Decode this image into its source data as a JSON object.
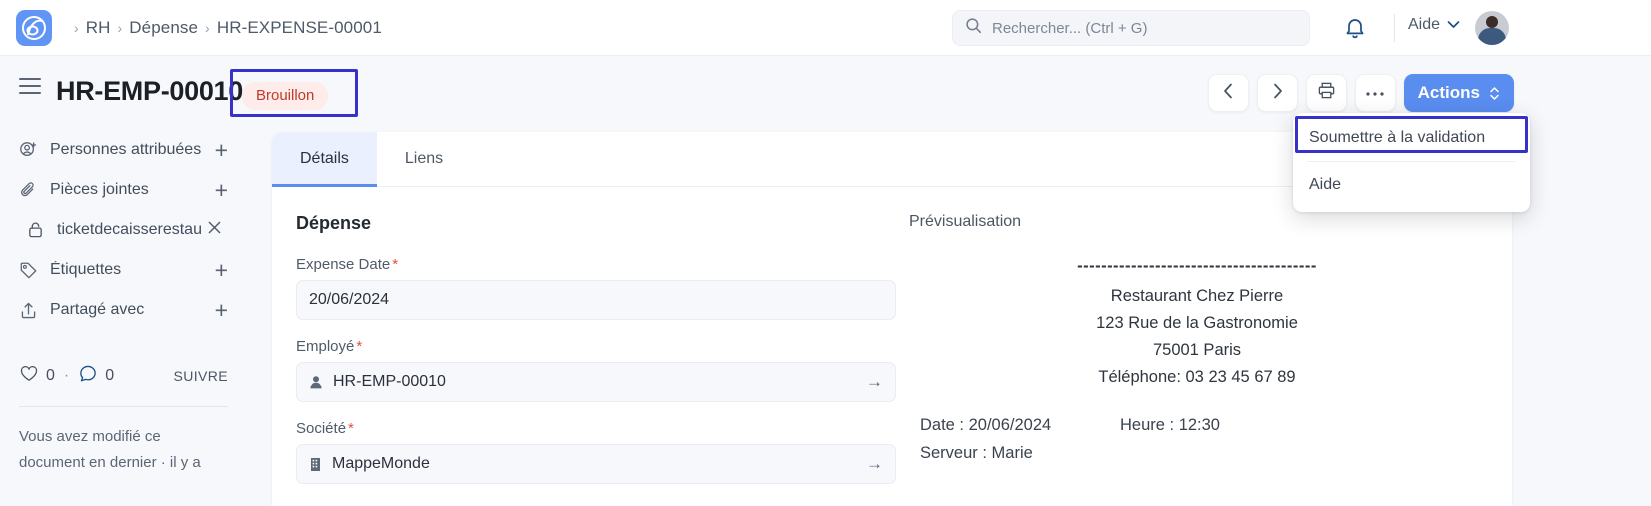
{
  "navbar": {
    "logo_icon": "app-logo-icon",
    "breadcrumb": {
      "sep": "›",
      "items": [
        "RH",
        "Dépense",
        "HR-EXPENSE-00001"
      ]
    },
    "search": {
      "icon": "search-icon",
      "placeholder": "Rechercher... (Ctrl + G)",
      "value": ""
    },
    "bell_icon": "notification-bell-icon",
    "help_label": "Aide",
    "help_caret_icon": "chevron-down-icon",
    "avatar_alt": "user-avatar"
  },
  "page_header": {
    "menu_icon": "hamburger-menu-icon",
    "title": "HR-EMP-00010",
    "status": "Brouillon",
    "toolbar": {
      "prev_icon": "chevron-left-icon",
      "next_icon": "chevron-right-icon",
      "print_icon": "printer-icon",
      "more_icon": "ellipsis-icon",
      "actions_label": "Actions",
      "actions_caret_icon": "chevron-updown-icon"
    }
  },
  "dropdown": {
    "items": [
      {
        "label": "Soumettre à la validation",
        "highlighted": true
      },
      {
        "label": "Aide",
        "highlighted": false
      }
    ]
  },
  "sidebar": {
    "items": [
      {
        "label": "Personnes attribuées",
        "icon": "user-plus-icon",
        "action": "+"
      },
      {
        "label": "Pièces jointes",
        "icon": "paperclip-icon",
        "action": "+"
      },
      {
        "label": "Étiquettes",
        "icon": "tag-icon",
        "action": "+"
      },
      {
        "label": "Partagé avec",
        "icon": "share-icon",
        "action": "+"
      }
    ],
    "attachment": {
      "name": "ticketdecaisserestau",
      "icon": "lock-icon",
      "remove_icon": "close-icon"
    },
    "stats": {
      "like_icon": "heart-icon",
      "like_count": "0",
      "separator": "·",
      "comment_icon": "comment-icon",
      "comment_count": "0",
      "follow_label": "SUIVRE"
    },
    "note": "Vous avez modifié ce document en dernier · il y a"
  },
  "main": {
    "tabs": [
      {
        "label": "Détails",
        "active": true
      },
      {
        "label": "Liens",
        "active": false
      }
    ],
    "section_title": "Dépense",
    "fields": [
      {
        "label": "Expense Date",
        "required": "*",
        "value": "20/06/2024",
        "icon": "",
        "arrow": ""
      },
      {
        "label": "Employé",
        "required": "*",
        "value": "HR-EMP-00010",
        "icon": "person-icon",
        "arrow": "→"
      },
      {
        "label": "Société",
        "required": "*",
        "value": "MappeMonde",
        "icon": "building-icon",
        "arrow": "→"
      }
    ],
    "preview": {
      "label": "Prévisualisation",
      "dashes": "----------------------------------------",
      "lines": [
        "Restaurant Chez Pierre",
        "123 Rue de la Gastronomie",
        "75001 Paris",
        "Téléphone: 03 23 45 67 89"
      ],
      "meta": [
        {
          "left": "Date : 20/06/2024",
          "right": "Heure : 12:30"
        },
        {
          "left": "Serveur : Marie",
          "right": ""
        }
      ]
    }
  },
  "colors": {
    "accent": "#5a8df0",
    "highlight_box": "#3730c9",
    "status_bg": "#fdecea",
    "status_fg": "#c0392b",
    "page_bg": "#f7f8fb"
  }
}
